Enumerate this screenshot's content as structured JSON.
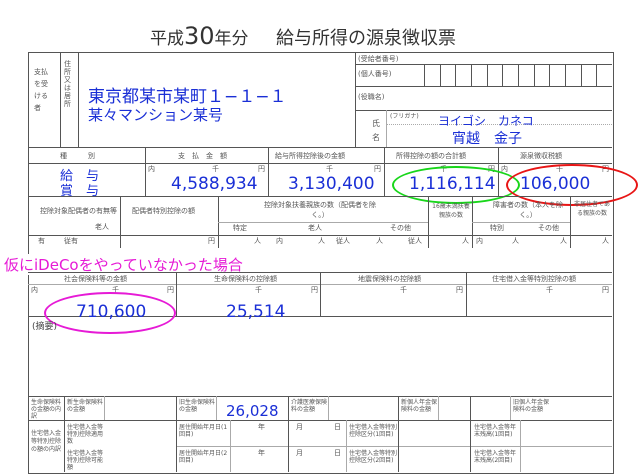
{
  "header": {
    "era": "平成",
    "year": "30",
    "suffix": "年分",
    "form_title": "給与所得の源泉徴収票"
  },
  "payee": {
    "label_pay": "支払を受ける者",
    "label_addr": "住所又は居所",
    "address_line1": "東京都某市某町１−１−１",
    "address_line2": "某々マンション某号",
    "recipient_no_label": "(受給者番号)",
    "personal_no_label": "(個人番号)",
    "title_label": "(役職名)",
    "name_label": "氏",
    "name_label2": "名",
    "furigana_label": "(フリガナ)",
    "furigana": "ヨイゴシ　カネコ",
    "name": "宵越　金子"
  },
  "amounts_header": {
    "type": "種　　　別",
    "paid": "支　払　金　額",
    "after_deduction": "給与所得控除後の金額",
    "total_deductions": "所得控除の額の合計額",
    "withholding": "源泉徴収税額",
    "unit_in": "内",
    "unit_sen": "千",
    "unit_en": "円"
  },
  "amounts": {
    "kind1": "給　与",
    "kind2": "賞　与",
    "paid": "4,588,934",
    "after_deduction": "3,130,400",
    "total_deductions": "1,116,114",
    "withholding": "106,000"
  },
  "dependents": {
    "spouse_label": "控除対象配偶者の有無等",
    "elderly": "老人",
    "spouse_special": "配偶者特別控除の額",
    "count_label": "控除対象扶養親族の数（配偶者を除く。）",
    "special": "特定",
    "old": "老人",
    "other": "その他",
    "under16": "16歳未満扶養親族の数",
    "disabled": "障害者の数（本人を除く。）",
    "special2": "特別",
    "other2": "その他",
    "nonresident": "非居住者である親族の数",
    "have": "有",
    "subordinate": "従有",
    "in": "内",
    "nin": "人",
    "juu": "従人"
  },
  "annotation": "仮にiDeCoをやっていなかった場合",
  "insurance": {
    "social_label": "社会保険料等の金額",
    "social_value": "710,600",
    "life_label": "生命保険料の控除額",
    "life_value": "25,514",
    "earthquake_label": "地震保険料の控除額",
    "housing_label": "住宅借入金等特別控除の額"
  },
  "remarks_label": "(摘要)",
  "bottom": {
    "c1": "生命保険料の金額の内訳",
    "c2": "新生命保険料の金額",
    "c3": "旧生命保険料の金額",
    "c4": "介護医療保険料の金額",
    "c4_value": "26,028",
    "c5": "新個人年金保険料の金額",
    "c6": "旧個人年金保険料の金額",
    "r1": "住宅借入金等特別控除の額の内訳",
    "r2": "住宅借入金等特別控除適用数",
    "r3": "居住開始年月日(1回目)",
    "r4": "住宅借入金等特別控除区分(1回目)",
    "r5": "住宅借入金等年末残高(1回目)",
    "r6": "住宅借入金等特別控除可能額",
    "r7": "居住開始年月日(2回目)",
    "r8": "住宅借入金等特別控除区分(2回目)",
    "r9": "住宅借入金等年末残高(2回目)",
    "nen": "年",
    "tsuki": "月",
    "hi": "日"
  },
  "colors": {
    "handwriting": "#1a2fd6",
    "annotation": "#e61ad6",
    "circle_green": "#18d61a",
    "circle_red": "#e81515",
    "circle_magenta": "#e61ad6"
  }
}
